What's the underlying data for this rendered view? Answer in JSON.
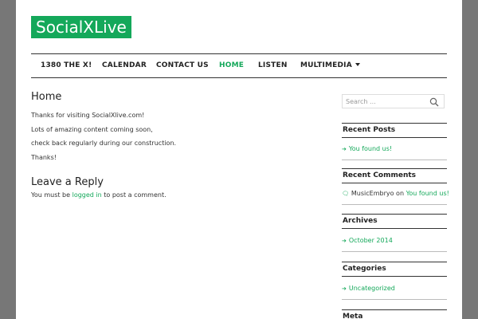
{
  "site": {
    "title": "SocialXLive"
  },
  "nav": {
    "items": [
      {
        "label": "1380 THE X!"
      },
      {
        "label": "CALENDAR"
      },
      {
        "label": "CONTACT US"
      },
      {
        "label": "HOME",
        "active": true
      },
      {
        "label": "LISTEN"
      },
      {
        "label": "MULTIMEDIA",
        "dropdown": true
      }
    ]
  },
  "main": {
    "title": "Home",
    "paragraphs": [
      "Thanks for visiting SocialXlive.com!",
      "Lots of amazing content coming soon,",
      "check back regularly during our construction.",
      "Thanks!"
    ],
    "reply": {
      "title": "Leave a Reply",
      "prefix": "You must be",
      "link": "logged in",
      "suffix": "to post a comment."
    }
  },
  "sidebar": {
    "search": {
      "placeholder": "Search ..."
    },
    "recent_posts": {
      "title": "Recent Posts",
      "items": [
        "You found us!"
      ]
    },
    "recent_comments": {
      "title": "Recent Comments",
      "author": "MusicEmbryo",
      "on": "on",
      "post": "You found us!"
    },
    "archives": {
      "title": "Archives",
      "items": [
        "October 2014"
      ]
    },
    "categories": {
      "title": "Categories",
      "items": [
        "Uncategorized"
      ]
    },
    "meta": {
      "title": "Meta"
    }
  },
  "colors": {
    "accent": "#14a85a",
    "background": "#777777",
    "page": "#ffffff"
  }
}
